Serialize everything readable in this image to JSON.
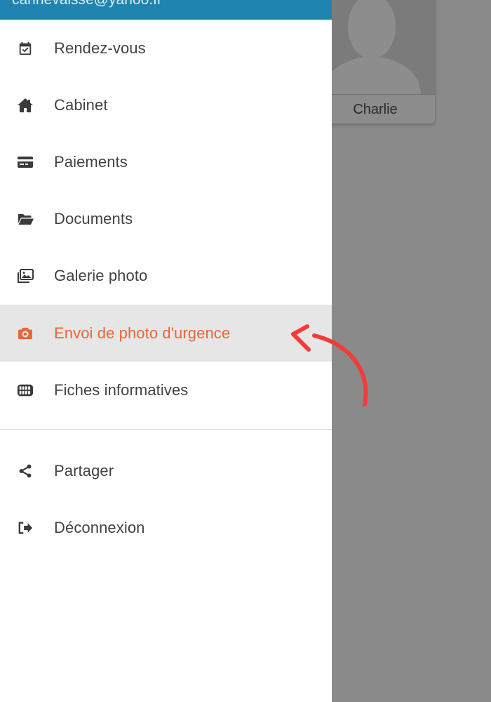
{
  "header": {
    "email": "cannevaisse@yahoo.fr",
    "color": "#1f84b0"
  },
  "background": {
    "card_name": "Charlie"
  },
  "menu": {
    "items": [
      {
        "label": "Rendez-vous",
        "icon": "calendar-check-icon"
      },
      {
        "label": "Cabinet",
        "icon": "home-icon"
      },
      {
        "label": "Paiements",
        "icon": "credit-card-icon"
      },
      {
        "label": "Documents",
        "icon": "folder-open-icon"
      },
      {
        "label": "Galerie photo",
        "icon": "photo-gallery-icon"
      },
      {
        "label": "Envoi de photo d'urgence",
        "icon": "camera-icon",
        "active": true
      },
      {
        "label": "Fiches informatives",
        "icon": "teeth-icon"
      }
    ],
    "secondary": [
      {
        "label": "Partager",
        "icon": "share-icon"
      },
      {
        "label": "Déconnexion",
        "icon": "logout-icon"
      }
    ]
  },
  "colors": {
    "active": "#e8673a",
    "annotation_arrow": "#f23b3b"
  }
}
